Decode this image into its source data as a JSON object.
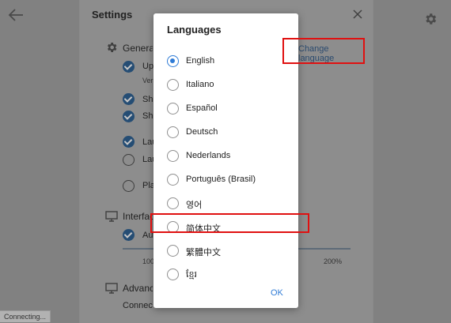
{
  "settings": {
    "title": "Settings",
    "sections": {
      "general": "General",
      "interface": "Interface",
      "advanced": "Advanced"
    },
    "general_items": {
      "updates": "Update automatically",
      "version": "Version",
      "show_tray": "Show tray icon",
      "show_taskbar": "Show taskbar icon",
      "launch_startup": "Launch on startup",
      "launch_minimized": "Launch minimized",
      "play_sounds": "Play sounds"
    },
    "interface_items": {
      "auto_scale": "Automatic scale"
    },
    "advanced_items": {
      "connection": "Connection type"
    },
    "change_language": "Change language",
    "zoom": {
      "min_label": "100%",
      "max_label": "200%",
      "value_fraction": 0.0
    }
  },
  "status": {
    "connecting": "Connecting..."
  },
  "dialog": {
    "title": "Languages",
    "options": [
      {
        "label": "English",
        "selected": true
      },
      {
        "label": "Italiano",
        "selected": false
      },
      {
        "label": "Español",
        "selected": false
      },
      {
        "label": "Deutsch",
        "selected": false
      },
      {
        "label": "Nederlands",
        "selected": false
      },
      {
        "label": "Português (Brasil)",
        "selected": false
      },
      {
        "label": "영어",
        "selected": false
      },
      {
        "label": "简体中文",
        "selected": false
      },
      {
        "label": "繁體中文",
        "selected": false
      },
      {
        "label": "ខ្មែរ",
        "selected": false
      }
    ],
    "ok_label": "OK"
  },
  "colors": {
    "accent": "#2f7bd6",
    "highlight": "#e01010",
    "overlay": "#8d8d8d"
  },
  "icons": {
    "back": "arrow-left-icon",
    "gear": "gear-icon",
    "close": "close-icon",
    "monitor": "monitor-icon"
  }
}
